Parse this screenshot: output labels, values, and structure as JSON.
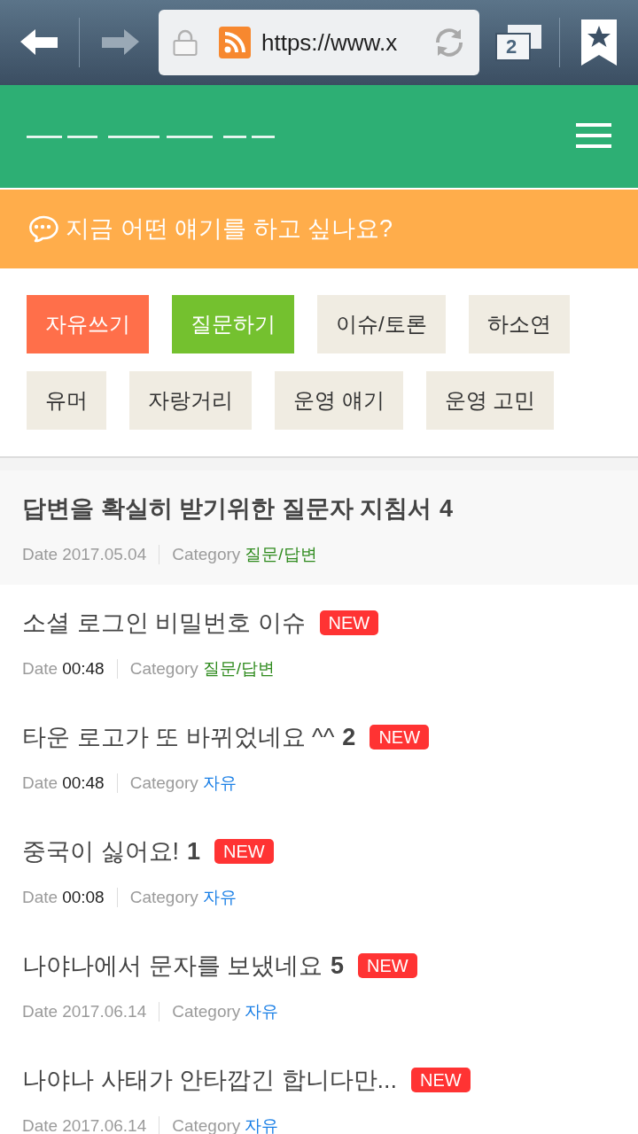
{
  "browser_toolbar": {
    "url": "https://www.x",
    "tab_count": "2"
  },
  "prompt_banner": {
    "text": "지금 어떤 얘기를 하고 싶나요?"
  },
  "categories": [
    {
      "label": "자유쓰기",
      "color": "#ff6f4a"
    },
    {
      "label": "질문하기",
      "color": "#74c12f"
    },
    {
      "label": "이슈/토론",
      "color": "#f0ece2"
    },
    {
      "label": "하소연",
      "color": "#f0ece2"
    },
    {
      "label": "유머",
      "color": "#f0ece2"
    },
    {
      "label": "자랑거리",
      "color": "#f0ece2"
    },
    {
      "label": "운영 얘기",
      "color": "#f0ece2"
    },
    {
      "label": "운영 고민",
      "color": "#f0ece2"
    }
  ],
  "posts": [
    {
      "kind": "notice",
      "title": "답변을 확실히 받기위한 질문자 지침서",
      "comment_count": "4",
      "date_label": "Date",
      "date": "2017.05.04",
      "date_highlighted": false,
      "category_label": "Category",
      "category": {
        "label": "질문/답변",
        "color": "#2e8a1d"
      }
    },
    {
      "kind": "post",
      "title": "소셜 로그인 비밀번호 이슈",
      "badge": "NEW",
      "date_label": "Date",
      "date": "00:48",
      "date_highlighted": true,
      "category_label": "Category",
      "category": {
        "label": "질문/답변",
        "color": "#2e8a1d"
      }
    },
    {
      "kind": "post",
      "title": "타운 로고가 또 바뀌었네요 ^^",
      "comment_count": "2",
      "badge": "NEW",
      "date_label": "Date",
      "date": "00:48",
      "date_highlighted": true,
      "category_label": "Category",
      "category": {
        "label": "자유",
        "color": "#1a7fe6"
      }
    },
    {
      "kind": "post",
      "title": "중국이 싫어요!",
      "comment_count": "1",
      "badge": "NEW",
      "date_label": "Date",
      "date": "00:08",
      "date_highlighted": true,
      "category_label": "Category",
      "category": {
        "label": "자유",
        "color": "#1a7fe6"
      }
    },
    {
      "kind": "post",
      "title": "나야나에서 문자를 보냈네요",
      "comment_count": "5",
      "badge": "NEW",
      "date_label": "Date",
      "date": "2017.06.14",
      "date_highlighted": false,
      "category_label": "Category",
      "category": {
        "label": "자유",
        "color": "#1a7fe6"
      }
    },
    {
      "kind": "post",
      "title": "나야나 사태가 안타깝긴 합니다만...",
      "badge": "NEW",
      "date_label": "Date",
      "date": "2017.06.14",
      "date_highlighted": false,
      "category_label": "Category",
      "category": {
        "label": "자유",
        "color": "#1a7fe6"
      }
    }
  ]
}
